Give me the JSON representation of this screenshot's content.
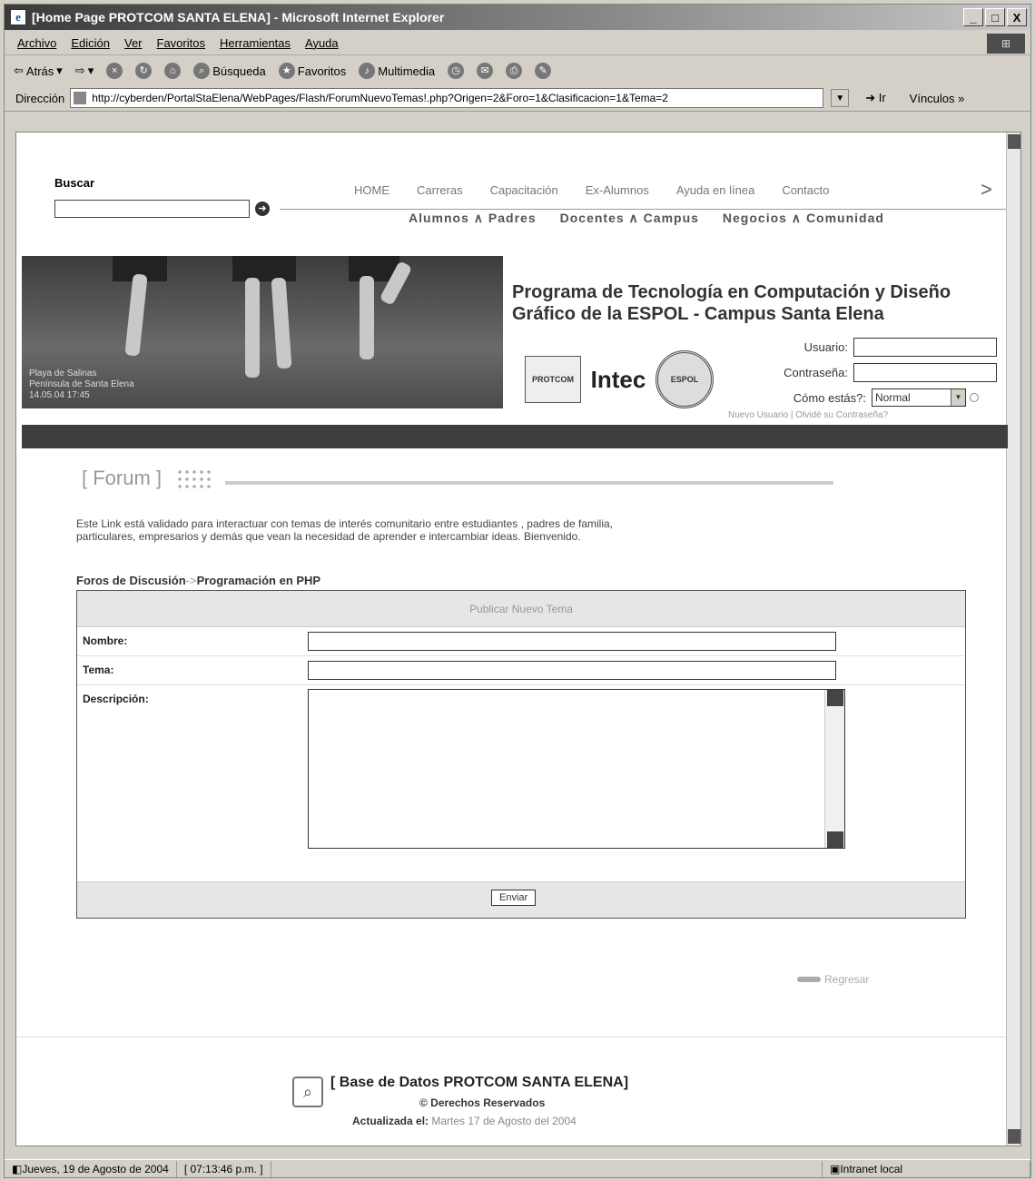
{
  "window": {
    "title": "[Home Page PROTCOM SANTA ELENA] - Microsoft Internet Explorer",
    "controls": [
      "_",
      "□",
      "X"
    ]
  },
  "menubar": [
    "Archivo",
    "Edición",
    "Ver",
    "Favoritos",
    "Herramientas",
    "Ayuda"
  ],
  "toolbar": {
    "back": "Atrás",
    "search": "Búsqueda",
    "favorites": "Favoritos",
    "multimedia": "Multimedia"
  },
  "address": {
    "label": "Dirección",
    "url": "http://cyberden/PortalStaElena/WebPages/Flash/ForumNuevoTemas!.php?Origen=2&Foro=1&Clasificacion=1&Tema=2",
    "go": "Ir",
    "links": "Vínculos »"
  },
  "site": {
    "search_label": "Buscar",
    "nav": [
      "HOME",
      "Carreras",
      "Capacitación",
      "Ex-Alumnos",
      "Ayuda en línea",
      "Contacto"
    ],
    "nav_more": ">",
    "subnav": [
      "Alumnos ∧ Padres",
      "Docentes ∧ Campus",
      "Negocios ∧ Comunidad"
    ],
    "banner_caption": [
      "Playa de Salinas",
      "Península de Santa Elena",
      "14.05.04  17:45"
    ],
    "program_title": "Programa de Tecnología en Computación y Diseño Gráfico de la ESPOL - Campus Santa Elena",
    "logos": {
      "protcom": "PROTCOM",
      "intec": "Intec",
      "espol": "ESPOL"
    },
    "login": {
      "user_label": "Usuario:",
      "password_label": "Contraseña:",
      "mood_label": "Cómo estás?:",
      "mood_value": "Normal",
      "links": "Nuevo Usuario  |  Olvidé su Contraseña?"
    }
  },
  "forum": {
    "title": "[ Forum ]",
    "intro": "Este Link está validado para interactuar con temas de interés comunitario entre estudiantes , padres de familia, particulares, empresarios y demás que vean la necesidad de aprender e intercambiar ideas. Bienvenido.",
    "breadcrumb_1": "Foros de Discusión",
    "breadcrumb_sep": "->",
    "breadcrumb_2": "Programación en PHP",
    "form": {
      "heading": "Publicar Nuevo Tema",
      "name_label": "Nombre:",
      "topic_label": "Tema:",
      "desc_label": "Descripción:",
      "submit": "Enviar"
    },
    "back": "Regresar"
  },
  "footer": {
    "title": "[ Base de Datos PROTCOM SANTA ELENA]",
    "copyright": "© Derechos Reservados",
    "updated_label": "Actualizada el:",
    "updated_value": "Martes 17 de Agosto del 2004"
  },
  "statusbar": {
    "date": "Jueves, 19 de Agosto de 2004",
    "time": "[ 07:13:46 p.m. ]",
    "zone": "Intranet local"
  }
}
